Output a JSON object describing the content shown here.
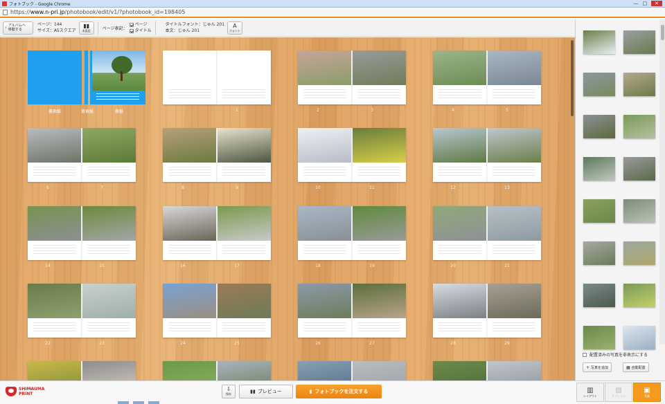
{
  "window": {
    "title": "フォトブック - Google Chrome",
    "controls": [
      "—",
      "□",
      "✕"
    ]
  },
  "browser": {
    "url_scheme": "https://",
    "url_host": "www.n-pri.jp",
    "url_path": "/photobook/edit/v1/?photobook_id=198405"
  },
  "toolbar": {
    "back_label_1": "アルバムへ",
    "back_label_2": "移動する",
    "pages_label": "ページ：144",
    "size_label": "サイズ：A5スクエア",
    "settings_label": "本設定",
    "page_display_label": "ページ表記：",
    "check_page": "ページ",
    "check_title": "タイトル",
    "title_font": "タイトルフォント：じゅん 201",
    "body_font": "本文：じゅん 201",
    "font_btn": "フォント",
    "font_glyph": "A"
  },
  "cover": {
    "labels": [
      "裏表紙",
      "背表紙",
      "表紙"
    ]
  },
  "spreads": [
    {
      "left": "",
      "right": "1"
    },
    {
      "left": "2",
      "right": "3"
    },
    {
      "left": "4",
      "right": "5"
    },
    {
      "left": "6",
      "right": "7"
    },
    {
      "left": "8",
      "right": "9"
    },
    {
      "left": "10",
      "right": "11"
    },
    {
      "left": "12",
      "right": "13"
    },
    {
      "left": "14",
      "right": "15"
    },
    {
      "left": "16",
      "right": "17"
    },
    {
      "left": "18",
      "right": "19"
    },
    {
      "left": "20",
      "right": "21"
    },
    {
      "left": "22",
      "right": "23"
    },
    {
      "left": "24",
      "right": "25"
    },
    {
      "left": "26",
      "right": "27"
    },
    {
      "left": "28",
      "right": "29"
    },
    {
      "left": "",
      "right": ""
    },
    {
      "left": "",
      "right": ""
    },
    {
      "left": "",
      "right": ""
    },
    {
      "left": "",
      "right": ""
    }
  ],
  "right_panel": {
    "hide_placed": "配置済みの写真を非表示にする",
    "add_photo": "写真を追加",
    "auto_place": "自動配置"
  },
  "bottom": {
    "logo_1": "SHIMAUMA",
    "logo_2": "PRINT",
    "save": "保存",
    "preview": "プレビュー",
    "order": "フォトブックを注文する",
    "mode_layout": "レイアウト",
    "mode_option": "オプション",
    "mode_photo": "写真"
  }
}
